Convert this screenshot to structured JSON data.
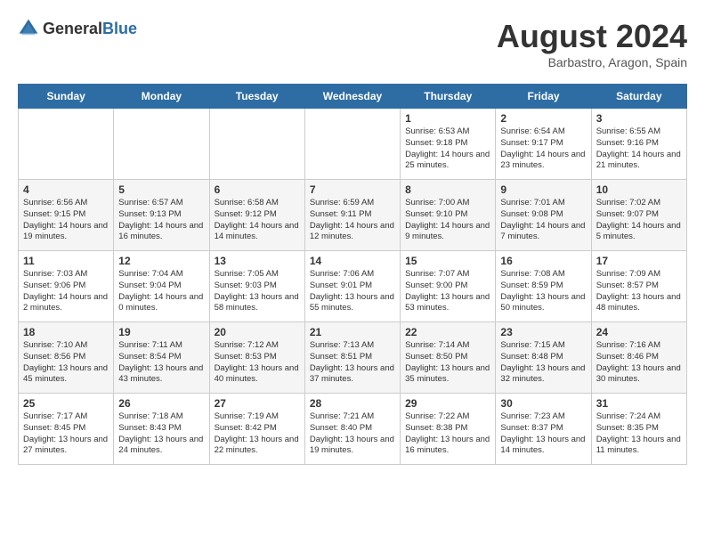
{
  "header": {
    "logo_general": "General",
    "logo_blue": "Blue",
    "month_year": "August 2024",
    "location": "Barbastro, Aragon, Spain"
  },
  "weekdays": [
    "Sunday",
    "Monday",
    "Tuesday",
    "Wednesday",
    "Thursday",
    "Friday",
    "Saturday"
  ],
  "weeks": [
    [
      {
        "day": "",
        "sunrise": "",
        "sunset": "",
        "daylight": ""
      },
      {
        "day": "",
        "sunrise": "",
        "sunset": "",
        "daylight": ""
      },
      {
        "day": "",
        "sunrise": "",
        "sunset": "",
        "daylight": ""
      },
      {
        "day": "",
        "sunrise": "",
        "sunset": "",
        "daylight": ""
      },
      {
        "day": "1",
        "sunrise": "Sunrise: 6:53 AM",
        "sunset": "Sunset: 9:18 PM",
        "daylight": "Daylight: 14 hours and 25 minutes."
      },
      {
        "day": "2",
        "sunrise": "Sunrise: 6:54 AM",
        "sunset": "Sunset: 9:17 PM",
        "daylight": "Daylight: 14 hours and 23 minutes."
      },
      {
        "day": "3",
        "sunrise": "Sunrise: 6:55 AM",
        "sunset": "Sunset: 9:16 PM",
        "daylight": "Daylight: 14 hours and 21 minutes."
      }
    ],
    [
      {
        "day": "4",
        "sunrise": "Sunrise: 6:56 AM",
        "sunset": "Sunset: 9:15 PM",
        "daylight": "Daylight: 14 hours and 19 minutes."
      },
      {
        "day": "5",
        "sunrise": "Sunrise: 6:57 AM",
        "sunset": "Sunset: 9:13 PM",
        "daylight": "Daylight: 14 hours and 16 minutes."
      },
      {
        "day": "6",
        "sunrise": "Sunrise: 6:58 AM",
        "sunset": "Sunset: 9:12 PM",
        "daylight": "Daylight: 14 hours and 14 minutes."
      },
      {
        "day": "7",
        "sunrise": "Sunrise: 6:59 AM",
        "sunset": "Sunset: 9:11 PM",
        "daylight": "Daylight: 14 hours and 12 minutes."
      },
      {
        "day": "8",
        "sunrise": "Sunrise: 7:00 AM",
        "sunset": "Sunset: 9:10 PM",
        "daylight": "Daylight: 14 hours and 9 minutes."
      },
      {
        "day": "9",
        "sunrise": "Sunrise: 7:01 AM",
        "sunset": "Sunset: 9:08 PM",
        "daylight": "Daylight: 14 hours and 7 minutes."
      },
      {
        "day": "10",
        "sunrise": "Sunrise: 7:02 AM",
        "sunset": "Sunset: 9:07 PM",
        "daylight": "Daylight: 14 hours and 5 minutes."
      }
    ],
    [
      {
        "day": "11",
        "sunrise": "Sunrise: 7:03 AM",
        "sunset": "Sunset: 9:06 PM",
        "daylight": "Daylight: 14 hours and 2 minutes."
      },
      {
        "day": "12",
        "sunrise": "Sunrise: 7:04 AM",
        "sunset": "Sunset: 9:04 PM",
        "daylight": "Daylight: 14 hours and 0 minutes."
      },
      {
        "day": "13",
        "sunrise": "Sunrise: 7:05 AM",
        "sunset": "Sunset: 9:03 PM",
        "daylight": "Daylight: 13 hours and 58 minutes."
      },
      {
        "day": "14",
        "sunrise": "Sunrise: 7:06 AM",
        "sunset": "Sunset: 9:01 PM",
        "daylight": "Daylight: 13 hours and 55 minutes."
      },
      {
        "day": "15",
        "sunrise": "Sunrise: 7:07 AM",
        "sunset": "Sunset: 9:00 PM",
        "daylight": "Daylight: 13 hours and 53 minutes."
      },
      {
        "day": "16",
        "sunrise": "Sunrise: 7:08 AM",
        "sunset": "Sunset: 8:59 PM",
        "daylight": "Daylight: 13 hours and 50 minutes."
      },
      {
        "day": "17",
        "sunrise": "Sunrise: 7:09 AM",
        "sunset": "Sunset: 8:57 PM",
        "daylight": "Daylight: 13 hours and 48 minutes."
      }
    ],
    [
      {
        "day": "18",
        "sunrise": "Sunrise: 7:10 AM",
        "sunset": "Sunset: 8:56 PM",
        "daylight": "Daylight: 13 hours and 45 minutes."
      },
      {
        "day": "19",
        "sunrise": "Sunrise: 7:11 AM",
        "sunset": "Sunset: 8:54 PM",
        "daylight": "Daylight: 13 hours and 43 minutes."
      },
      {
        "day": "20",
        "sunrise": "Sunrise: 7:12 AM",
        "sunset": "Sunset: 8:53 PM",
        "daylight": "Daylight: 13 hours and 40 minutes."
      },
      {
        "day": "21",
        "sunrise": "Sunrise: 7:13 AM",
        "sunset": "Sunset: 8:51 PM",
        "daylight": "Daylight: 13 hours and 37 minutes."
      },
      {
        "day": "22",
        "sunrise": "Sunrise: 7:14 AM",
        "sunset": "Sunset: 8:50 PM",
        "daylight": "Daylight: 13 hours and 35 minutes."
      },
      {
        "day": "23",
        "sunrise": "Sunrise: 7:15 AM",
        "sunset": "Sunset: 8:48 PM",
        "daylight": "Daylight: 13 hours and 32 minutes."
      },
      {
        "day": "24",
        "sunrise": "Sunrise: 7:16 AM",
        "sunset": "Sunset: 8:46 PM",
        "daylight": "Daylight: 13 hours and 30 minutes."
      }
    ],
    [
      {
        "day": "25",
        "sunrise": "Sunrise: 7:17 AM",
        "sunset": "Sunset: 8:45 PM",
        "daylight": "Daylight: 13 hours and 27 minutes."
      },
      {
        "day": "26",
        "sunrise": "Sunrise: 7:18 AM",
        "sunset": "Sunset: 8:43 PM",
        "daylight": "Daylight: 13 hours and 24 minutes."
      },
      {
        "day": "27",
        "sunrise": "Sunrise: 7:19 AM",
        "sunset": "Sunset: 8:42 PM",
        "daylight": "Daylight: 13 hours and 22 minutes."
      },
      {
        "day": "28",
        "sunrise": "Sunrise: 7:21 AM",
        "sunset": "Sunset: 8:40 PM",
        "daylight": "Daylight: 13 hours and 19 minutes."
      },
      {
        "day": "29",
        "sunrise": "Sunrise: 7:22 AM",
        "sunset": "Sunset: 8:38 PM",
        "daylight": "Daylight: 13 hours and 16 minutes."
      },
      {
        "day": "30",
        "sunrise": "Sunrise: 7:23 AM",
        "sunset": "Sunset: 8:37 PM",
        "daylight": "Daylight: 13 hours and 14 minutes."
      },
      {
        "day": "31",
        "sunrise": "Sunrise: 7:24 AM",
        "sunset": "Sunset: 8:35 PM",
        "daylight": "Daylight: 13 hours and 11 minutes."
      }
    ]
  ]
}
